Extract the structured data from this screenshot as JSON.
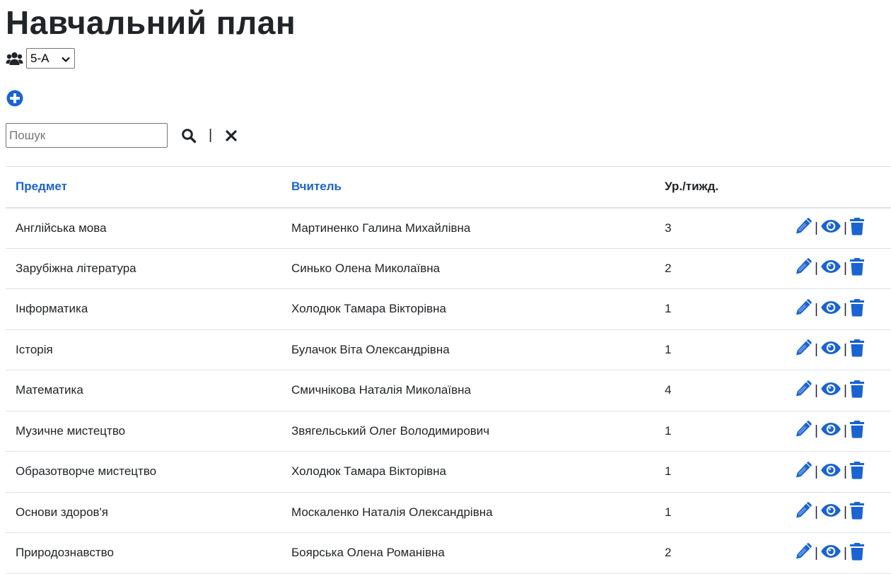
{
  "page": {
    "title": "Навчальний план"
  },
  "class_selector": {
    "selected": "5-А"
  },
  "search": {
    "placeholder": "Пошук",
    "value": "",
    "separator": "|"
  },
  "table": {
    "headers": {
      "subject": "Предмет",
      "teacher": "Вчитель",
      "hours": "Ур./тижд."
    },
    "rows": [
      {
        "subject": "Англійська мова",
        "teacher": "Мартиненко Галина Михайлівна",
        "hours": "3"
      },
      {
        "subject": "Зарубіжна література",
        "teacher": "Синько Олена Миколаївна",
        "hours": "2"
      },
      {
        "subject": "Інформатика",
        "teacher": "Холодюк Тамара Вікторівна",
        "hours": "1"
      },
      {
        "subject": "Історія",
        "teacher": "Булачок Віта Олександрівна",
        "hours": "1"
      },
      {
        "subject": "Математика",
        "teacher": "Смичнікова Наталія Миколаївна",
        "hours": "4"
      },
      {
        "subject": "Музичне мистецтво",
        "teacher": "Звягельський Олег Володимирович",
        "hours": "1"
      },
      {
        "subject": "Образотворче мистецтво",
        "teacher": "Холодюк Тамара Вікторівна",
        "hours": "1"
      },
      {
        "subject": "Основи здоров'я",
        "teacher": "Москаленко Наталія Олександрівна",
        "hours": "1"
      },
      {
        "subject": "Природознавство",
        "teacher": "Боярська Олена Романівна",
        "hours": "2"
      }
    ],
    "action_separator": "|",
    "row_actions": [
      "pencil-icon",
      "eye-icon",
      "trash-icon"
    ]
  },
  "icons": {
    "class": "users-icon",
    "add": "plus-circle-icon",
    "search": "search-icon",
    "clear": "close-icon",
    "select_arrow": "chevron-down-icon"
  },
  "colors": {
    "accent": "#1a63d2",
    "text": "#212529",
    "border": "#dee2e6"
  }
}
